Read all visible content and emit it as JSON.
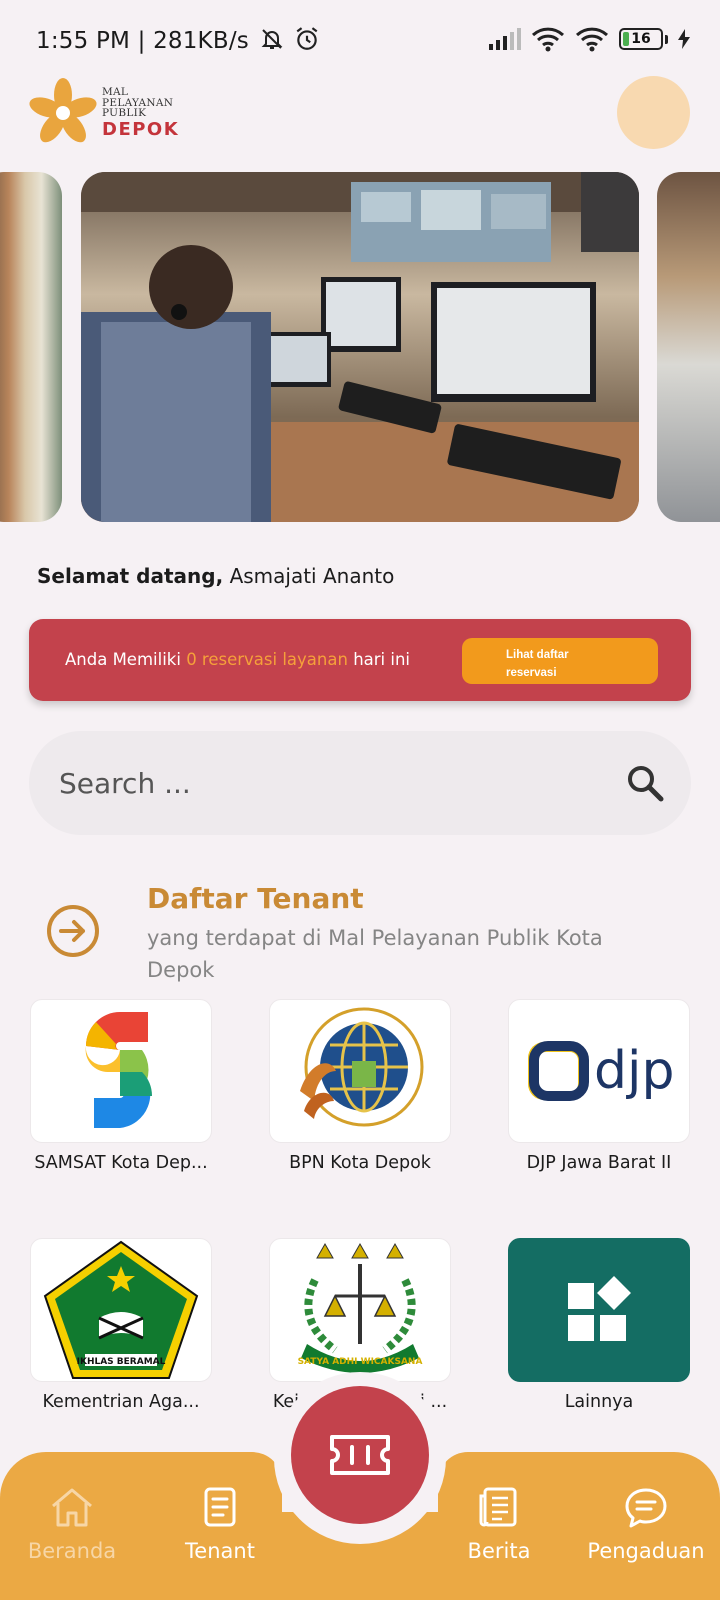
{
  "status_bar": {
    "time": "1:55 PM",
    "speed": "281KB/s",
    "battery": "16"
  },
  "header": {
    "logo_line1": "MAL",
    "logo_line2": "PELAYANAN",
    "logo_line3": "PUBLIK",
    "logo_city": "DEPOK"
  },
  "welcome": {
    "greeting": "Selamat datang,",
    "name": "Asmajati Ananto"
  },
  "reservation": {
    "prefix": "Anda Memiliki",
    "highlight": "0 reservasi layanan",
    "suffix": "hari ini",
    "button_line1": "Lihat daftar",
    "button_line2": "reservasi"
  },
  "search": {
    "placeholder": "Search ..."
  },
  "section": {
    "title": "Daftar Tenant",
    "subtitle": "yang terdapat di Mal Pelayanan Publik Kota Depok"
  },
  "tenants": [
    {
      "name": "SAMSAT Kota Dep...",
      "icon": "samsat-logo"
    },
    {
      "name": "BPN Kota Depok",
      "icon": "bpn-logo"
    },
    {
      "name": "DJP Jawa Barat II",
      "icon": "djp-logo"
    },
    {
      "name": "Kementrian Aga...",
      "icon": "kemenag-logo"
    },
    {
      "name": "Kejaksaan Negeri ...",
      "icon": "kejaksaan-logo"
    },
    {
      "name": "Lainnya",
      "icon": "grid-icon"
    }
  ],
  "nav": {
    "home": "Beranda",
    "tenant": "Tenant",
    "news": "Berita",
    "complaint": "Pengaduan"
  },
  "colors": {
    "brand_red": "#c3424c",
    "brand_orange": "#eba944",
    "accent_gold": "#c98a35",
    "teal": "#146d63"
  }
}
